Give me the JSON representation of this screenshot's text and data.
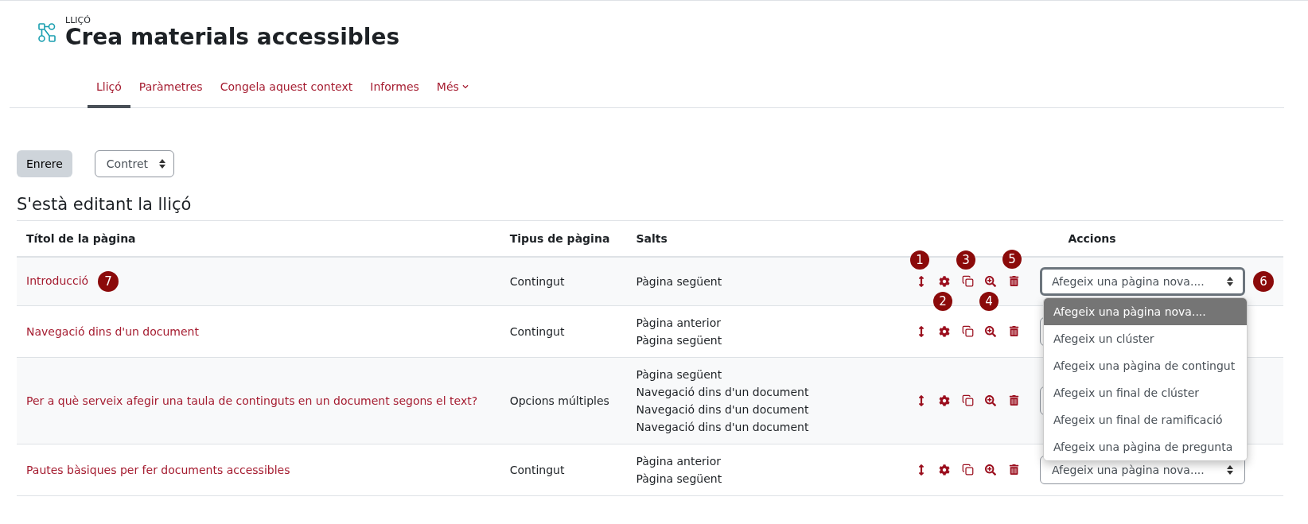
{
  "header": {
    "kicker": "LLIÇÓ",
    "title": "Crea materials accessibles"
  },
  "tabs": [
    {
      "label": "Lliçó",
      "selected": true
    },
    {
      "label": "Paràmetres",
      "selected": false
    },
    {
      "label": "Congela aquest context",
      "selected": false
    },
    {
      "label": "Informes",
      "selected": false
    },
    {
      "label": "Més",
      "selected": false,
      "kind": "menu"
    }
  ],
  "back_button": "Enrere",
  "view_select": "Contret",
  "section_title": "S'està editant la lliçó",
  "table": {
    "columns": [
      "Títol de la pàgina",
      "Tipus de pàgina",
      "Salts",
      "Accions"
    ],
    "rows": [
      {
        "title": "Introducció",
        "title_callout": "7",
        "type": "Contingut",
        "jumps": [
          "Pàgina següent"
        ],
        "select": "Afegeix una pàgina nova....",
        "select_focused": true,
        "select_callout": "6",
        "actions": [
          {
            "kind": "move",
            "callout": "1"
          },
          {
            "kind": "settings",
            "callout": "2"
          },
          {
            "kind": "copy",
            "callout": "3"
          },
          {
            "kind": "preview",
            "callout": "4"
          },
          {
            "kind": "delete",
            "callout": "5"
          }
        ]
      },
      {
        "title": "Navegació dins d'un document",
        "type": "Contingut",
        "jumps": [
          "Pàgina anterior",
          "Pàgina següent"
        ],
        "select_focused": false,
        "actions": [
          {
            "kind": "move"
          },
          {
            "kind": "settings"
          },
          {
            "kind": "copy"
          },
          {
            "kind": "preview"
          },
          {
            "kind": "delete"
          }
        ]
      },
      {
        "title": "Per a què serveix afegir una taula de continguts en un document segons el text?",
        "type": "Opcions múltiples",
        "jumps": [
          "Pàgina següent",
          "Navegació dins d'un document",
          "Navegació dins d'un document",
          "Navegació dins d'un document"
        ],
        "select_focused": false,
        "actions": [
          {
            "kind": "move"
          },
          {
            "kind": "settings"
          },
          {
            "kind": "copy"
          },
          {
            "kind": "preview"
          },
          {
            "kind": "delete"
          }
        ]
      },
      {
        "title": "Pautes bàsiques per fer documents accessibles",
        "type": "Contingut",
        "jumps": [
          "Pàgina anterior",
          "Pàgina següent"
        ],
        "select": "Afegeix una pàgina nova....",
        "select_focused": false,
        "actions": [
          {
            "kind": "move"
          },
          {
            "kind": "settings"
          },
          {
            "kind": "copy"
          },
          {
            "kind": "preview"
          },
          {
            "kind": "delete"
          }
        ]
      }
    ]
  },
  "dropdown": [
    {
      "label": "Afegeix una pàgina nova....",
      "selected": true
    },
    {
      "label": "Afegeix un clúster",
      "selected": false
    },
    {
      "label": "Afegeix una pàgina de contingut",
      "selected": false
    },
    {
      "label": "Afegeix un final de clúster",
      "selected": false
    },
    {
      "label": "Afegeix un final de ramificació",
      "selected": false
    },
    {
      "label": "Afegeix una pàgina de pregunta",
      "selected": false
    }
  ]
}
